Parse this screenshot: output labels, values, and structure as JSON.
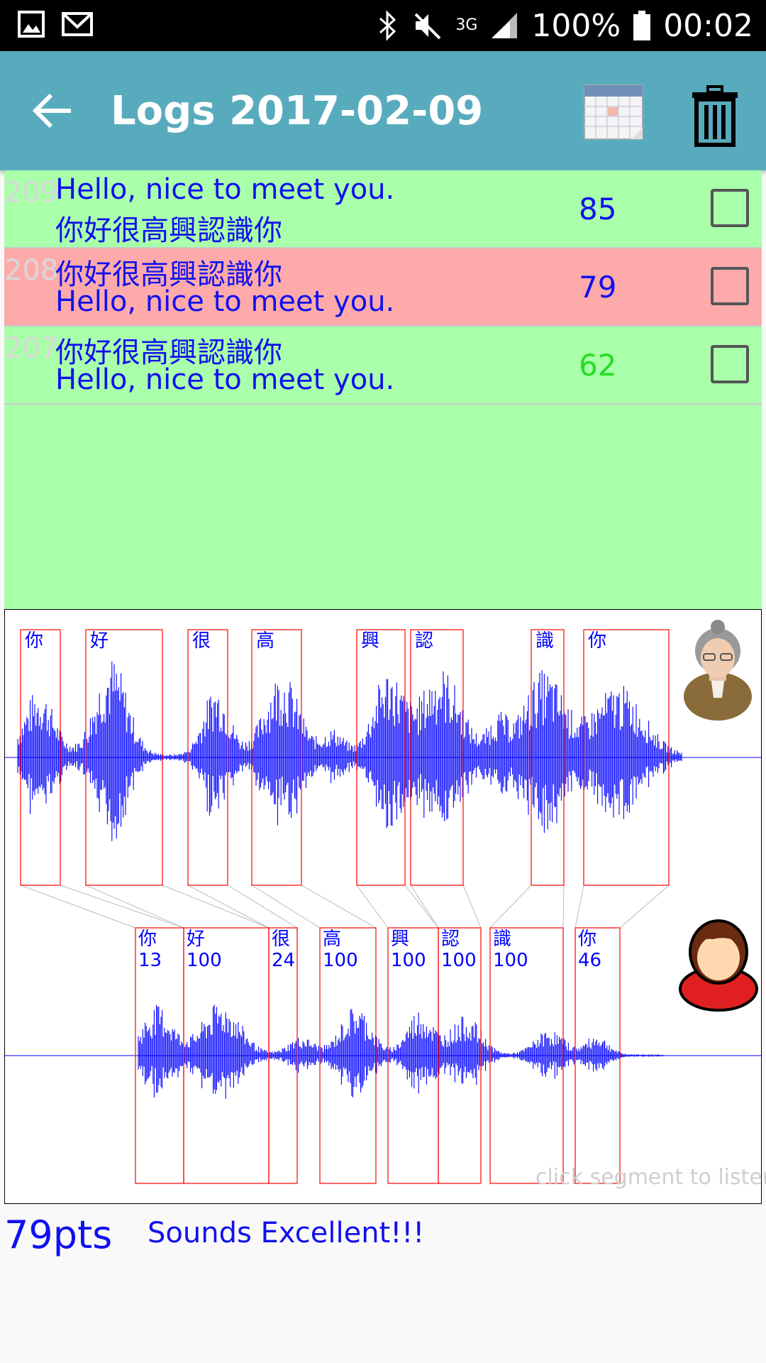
{
  "status_bar": {
    "battery": "100%",
    "time": "00:02",
    "network": "3G"
  },
  "app_bar": {
    "title": "Logs 2017-02-09",
    "background": "#58abbd"
  },
  "logs": [
    {
      "id": "209",
      "line1": "Hello, nice to meet you.",
      "line2": "你好很高興認識你",
      "score": "85",
      "score_color": "#1010f0",
      "row_color": "#aaffaa"
    },
    {
      "id": "208",
      "line1": "你好很高興認識你",
      "line2": "Hello, nice to meet you.",
      "score": "79",
      "score_color": "#1010f0",
      "row_color": "#ffaaaa"
    },
    {
      "id": "207",
      "line1": "你好很高興認識你",
      "line2": "Hello, nice to meet you.",
      "score": "62",
      "score_color": "#22dd22",
      "row_color": "#aaffaa"
    }
  ],
  "reference_segments": [
    "你",
    "好",
    "很",
    "高",
    "興",
    "認",
    "識",
    "你"
  ],
  "user_segments": [
    {
      "char": "你",
      "score": "13"
    },
    {
      "char": "好",
      "score": "100"
    },
    {
      "char": "很",
      "score": "24"
    },
    {
      "char": "高",
      "score": "100"
    },
    {
      "char": "興",
      "score": "100"
    },
    {
      "char": "認",
      "score": "100"
    },
    {
      "char": "識",
      "score": "100"
    },
    {
      "char": "你",
      "score": "46"
    }
  ],
  "hint": "click segment to listen",
  "result": {
    "points": "79pts",
    "verdict": "Sounds Excellent!!!"
  }
}
